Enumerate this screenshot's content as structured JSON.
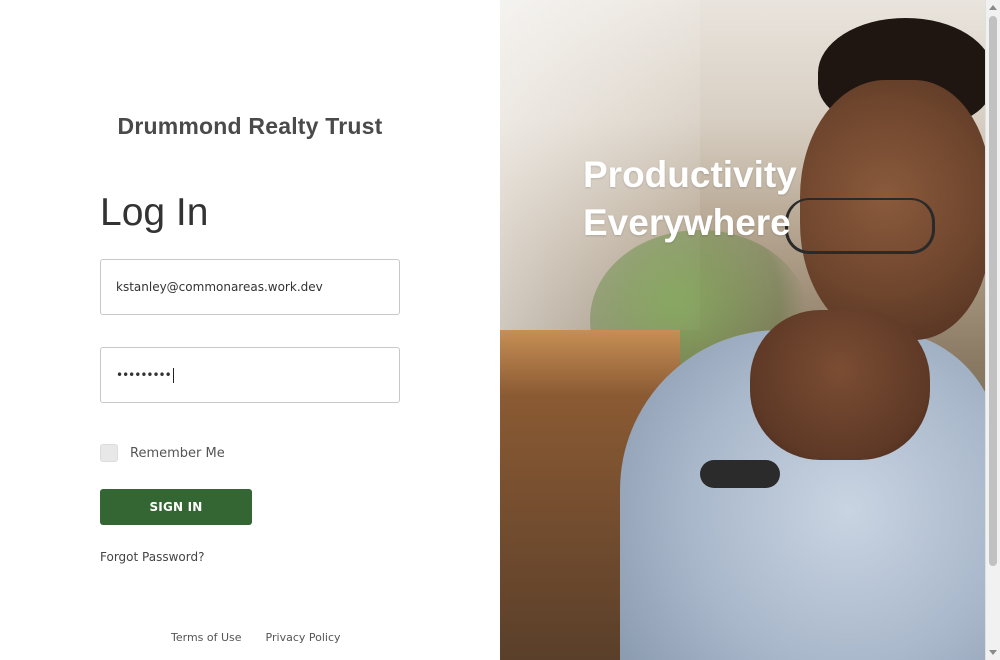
{
  "brand": {
    "name": "Drummond Realty Trust"
  },
  "login": {
    "title": "Log In",
    "email_value": "kstanley@commonareas.work.dev",
    "password_masked": "•••••••••",
    "remember_label": "Remember Me",
    "remember_checked": false,
    "signin_label": "SIGN IN",
    "forgot_label": "Forgot Password?"
  },
  "footer": {
    "terms_label": "Terms of Use",
    "privacy_label": "Privacy Policy"
  },
  "hero": {
    "tagline_line1": "Productivity",
    "tagline_line2": "Everywhere"
  },
  "colors": {
    "primary_button": "#336633",
    "text_dark": "#333333",
    "text_brand": "#4a4a4a",
    "field_border": "#c8c8c8",
    "hero_text": "#ffffff"
  },
  "icons": {
    "scroll_up": "scroll-up-icon",
    "scroll_down": "scroll-down-icon"
  }
}
